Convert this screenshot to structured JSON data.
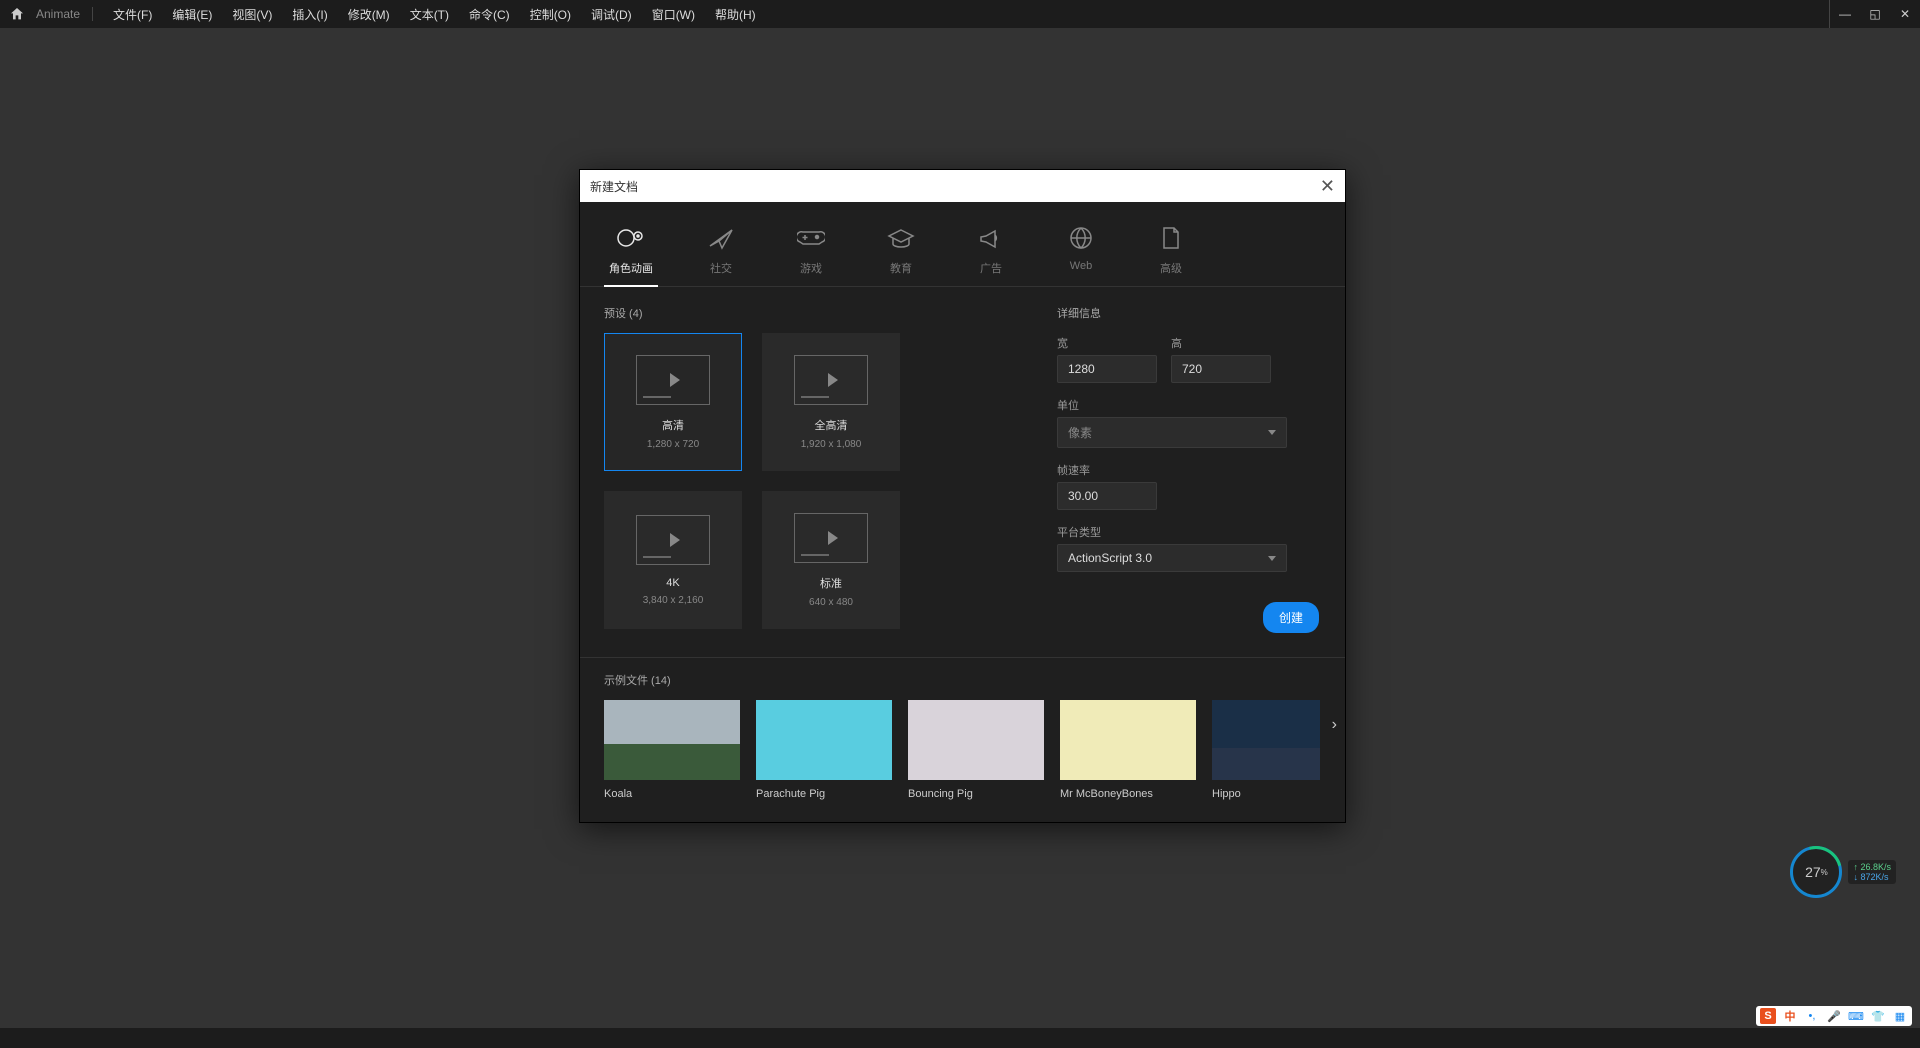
{
  "app": {
    "name": "Animate"
  },
  "menu": [
    "文件(F)",
    "编辑(E)",
    "视图(V)",
    "插入(I)",
    "修改(M)",
    "文本(T)",
    "命令(C)",
    "控制(O)",
    "调试(D)",
    "窗口(W)",
    "帮助(H)"
  ],
  "dialog": {
    "title": "新建文档",
    "categories": [
      {
        "label": "角色动画"
      },
      {
        "label": "社交"
      },
      {
        "label": "游戏"
      },
      {
        "label": "教育"
      },
      {
        "label": "广告"
      },
      {
        "label": "Web"
      },
      {
        "label": "高级"
      }
    ],
    "presets_title": "预设 (4)",
    "presets": [
      {
        "name": "高清",
        "dims": "1,280 x 720"
      },
      {
        "name": "全高清",
        "dims": "1,920 x 1,080"
      },
      {
        "name": "4K",
        "dims": "3,840 x 2,160"
      },
      {
        "name": "标准",
        "dims": "640 x 480"
      }
    ],
    "details": {
      "title": "详细信息",
      "width_label": "宽",
      "width": "1280",
      "height_label": "高",
      "height": "720",
      "units_label": "单位",
      "units": "像素",
      "fps_label": "帧速率",
      "fps": "30.00",
      "platform_label": "平台类型",
      "platform": "ActionScript 3.0",
      "create": "创建"
    },
    "samples_title": "示例文件 (14)",
    "samples": [
      {
        "name": "Koala"
      },
      {
        "name": "Parachute Pig"
      },
      {
        "name": "Bouncing Pig"
      },
      {
        "name": "Mr McBoneyBones"
      },
      {
        "name": "Hippo"
      }
    ]
  },
  "gauge": {
    "pct": "27",
    "unit": "%"
  },
  "net": {
    "up": "26.8K/s",
    "down": "872K/s"
  },
  "ime": {
    "logo": "S",
    "lang": "中"
  }
}
